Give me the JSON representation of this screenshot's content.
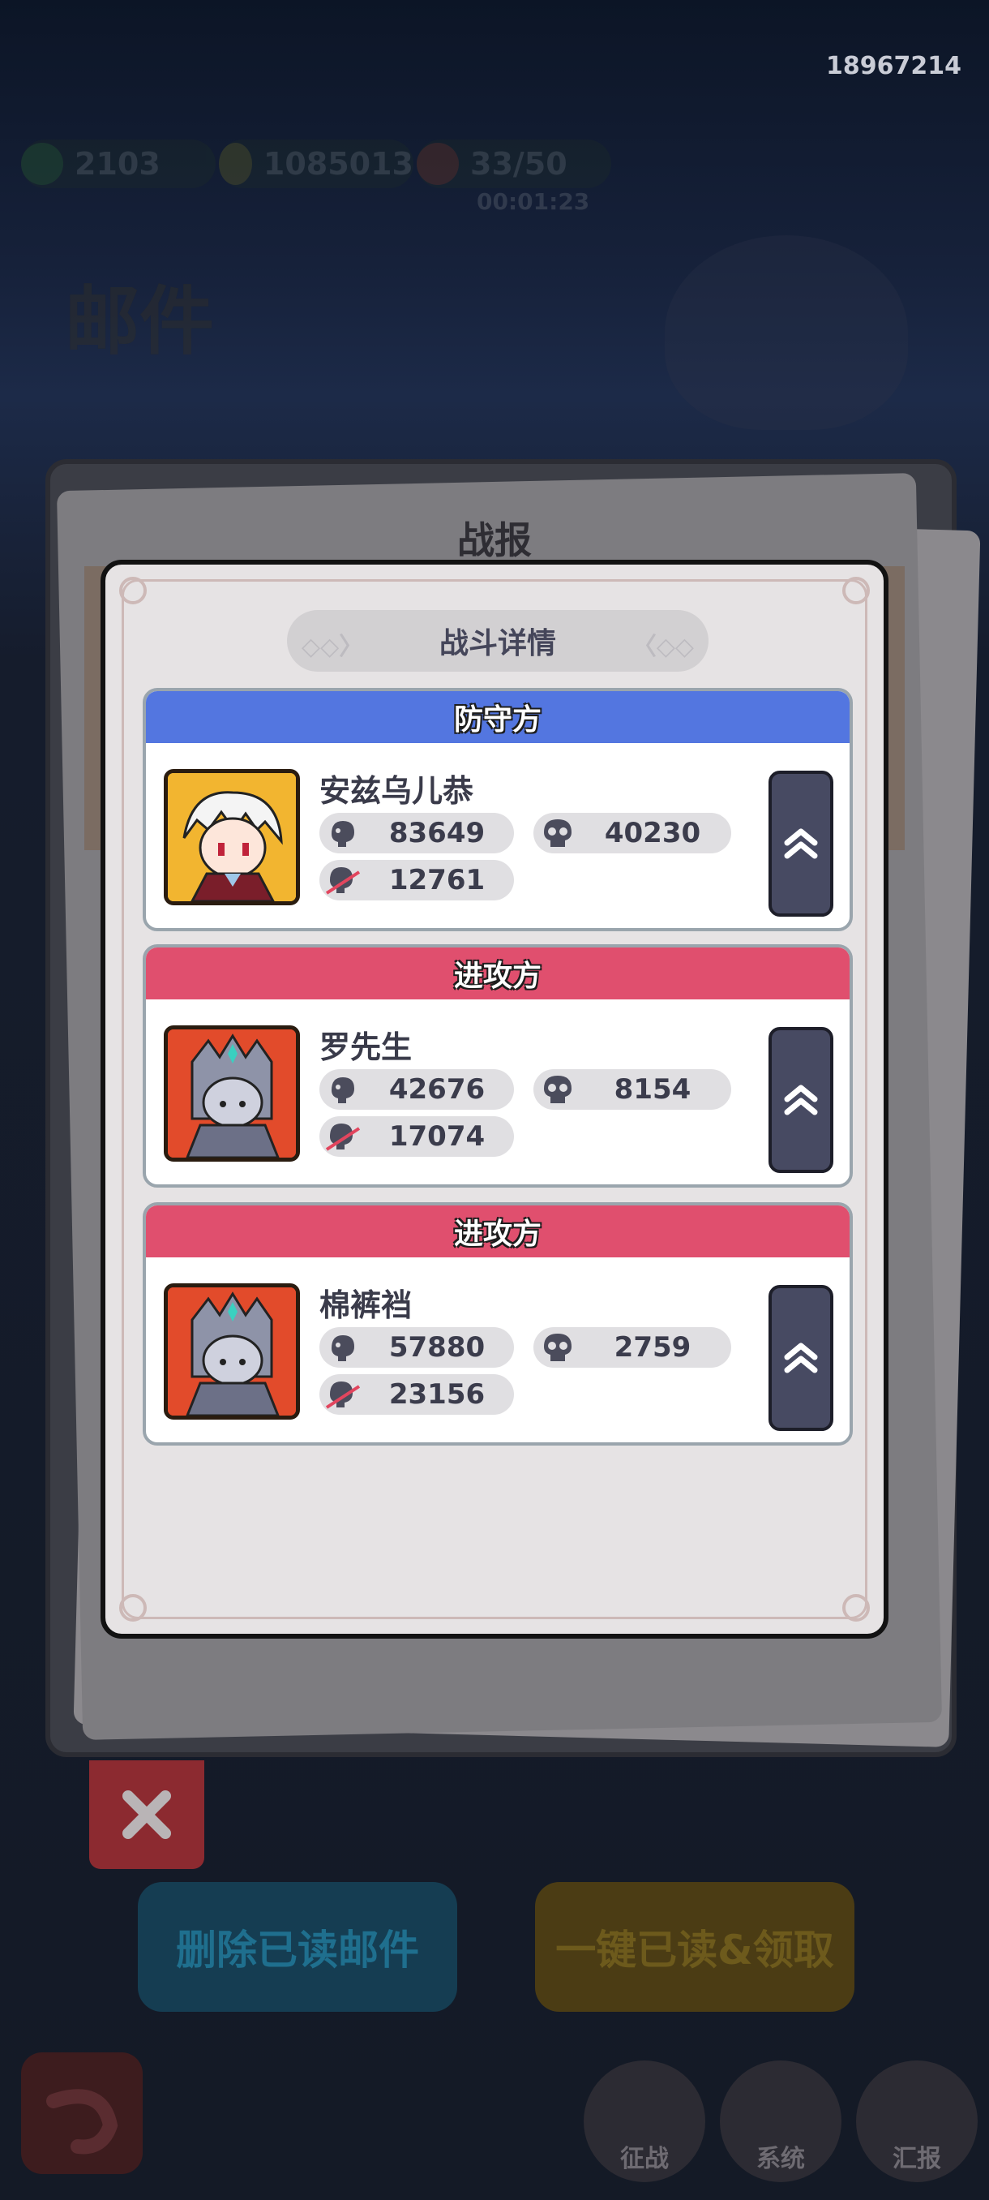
{
  "header": {
    "user_id": "18967214",
    "resources": [
      {
        "icon": "green-gem-icon",
        "value": "2103"
      },
      {
        "icon": "gold-coin-icon",
        "value": "1085013"
      },
      {
        "icon": "stamina-icon",
        "value": "33/50"
      }
    ],
    "timer": "00:01:23",
    "page_title": "邮件"
  },
  "report": {
    "title": "战报",
    "tab_title": "战斗详情"
  },
  "cards": [
    {
      "side": "防守方",
      "side_color": "#5376e0",
      "name": "安兹乌儿恭",
      "portrait": "white-hair-hero-portrait",
      "damage": "83649",
      "kills": "40230",
      "losses": "12761"
    },
    {
      "side": "进攻方",
      "side_color": "#e04f6e",
      "name": "罗先生",
      "portrait": "silver-armor-hero-portrait",
      "damage": "42676",
      "kills": "8154",
      "losses": "17074"
    },
    {
      "side": "进攻方",
      "side_color": "#e04f6e",
      "name": "棉裤裆",
      "portrait": "silver-armor-hero-portrait",
      "damage": "57880",
      "kills": "2759",
      "losses": "23156"
    }
  ],
  "background": {
    "delete_read_label": "删除已读邮件",
    "read_claim_label": "一键已读&领取",
    "nav": [
      {
        "label": "征战"
      },
      {
        "label": "系统"
      },
      {
        "label": "汇报"
      }
    ]
  }
}
